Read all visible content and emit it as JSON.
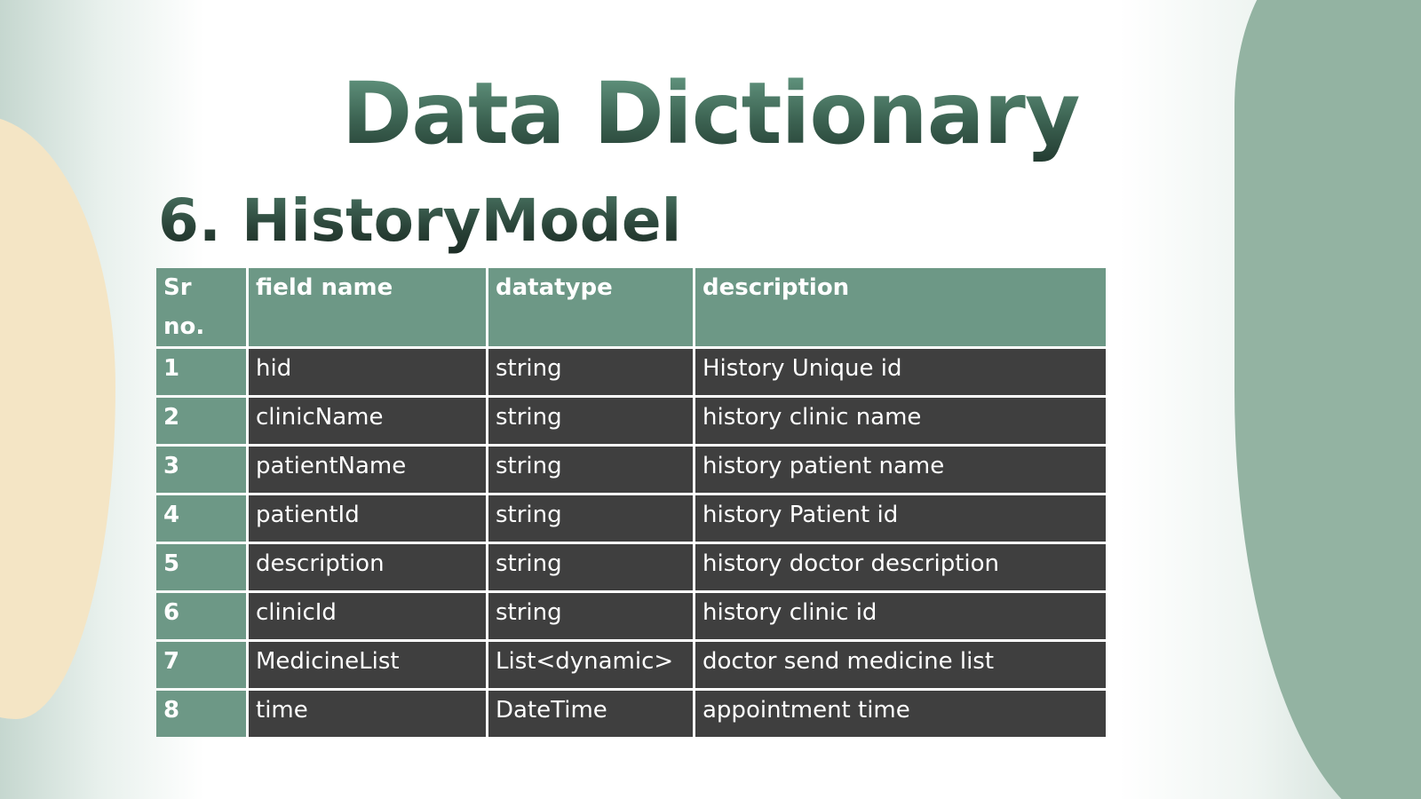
{
  "slide": {
    "title": "Data Dictionary",
    "subtitle": "6. HistoryModel"
  },
  "table": {
    "headers": [
      "Sr no.",
      "field name",
      "datatype",
      "description"
    ],
    "rows": [
      [
        "1",
        "hid",
        "string",
        "History Unique id"
      ],
      [
        "2",
        "clinicName",
        "string",
        "history clinic name"
      ],
      [
        "3",
        "patientName",
        "string",
        "history patient name"
      ],
      [
        "4",
        "patientId",
        "string",
        "history Patient id"
      ],
      [
        "5",
        "description",
        "string",
        "history doctor description"
      ],
      [
        "6",
        "clinicId",
        "string",
        "history clinic id"
      ],
      [
        "7",
        "MedicineList",
        "List<dynamic>",
        "doctor send medicine list"
      ],
      [
        "8",
        "time",
        "DateTime",
        "appointment time"
      ]
    ]
  },
  "colors": {
    "header_green": "#6d9886",
    "cell_dark": "#3f3f3f",
    "accent_sage": "#93b3a2",
    "accent_sand": "#f4e5c5"
  }
}
